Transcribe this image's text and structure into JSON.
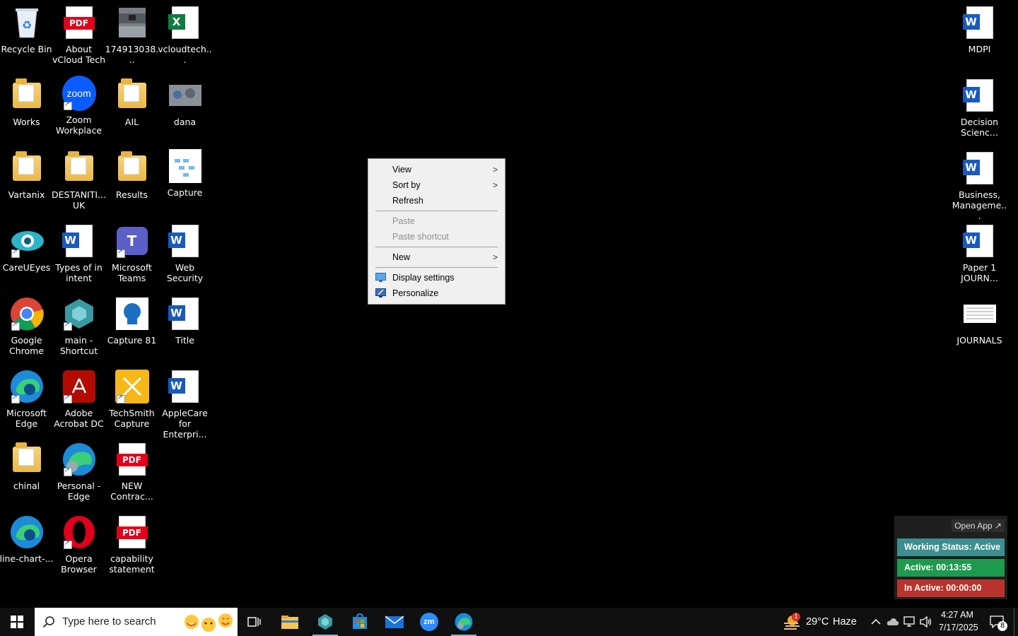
{
  "desktop": {
    "left_icons": [
      {
        "label": "Recycle Bin"
      },
      {
        "label": "About vCloud Tech"
      },
      {
        "label": "174913038..."
      },
      {
        "label": "vcloudtech..."
      },
      {
        "label": "Works"
      },
      {
        "label": "Zoom Workplace"
      },
      {
        "label": "AIL"
      },
      {
        "label": "dana"
      },
      {
        "label": "Vartanix"
      },
      {
        "label": "DESTANITI... UK"
      },
      {
        "label": "Results"
      },
      {
        "label": "Capture"
      },
      {
        "label": "CareUEyes"
      },
      {
        "label": "Types of in intent"
      },
      {
        "label": "Microsoft Teams"
      },
      {
        "label": "Web Security"
      },
      {
        "label": "Google Chrome"
      },
      {
        "label": "main - Shortcut"
      },
      {
        "label": "Capture 81"
      },
      {
        "label": "Title"
      },
      {
        "label": "Microsoft Edge"
      },
      {
        "label": "Adobe Acrobat DC"
      },
      {
        "label": "TechSmith Capture"
      },
      {
        "label": "AppleCare for Enterpri..."
      },
      {
        "label": "chinal"
      },
      {
        "label": "Personal - Edge"
      },
      {
        "label": "NEW Contrac..."
      },
      {
        "label": "line-chart-..."
      },
      {
        "label": "Opera Browser"
      },
      {
        "label": "capability statement"
      }
    ],
    "right_icons": [
      {
        "label": "MDPI"
      },
      {
        "label": "Decision Scienc..."
      },
      {
        "label": "Business, Manageme..."
      },
      {
        "label": "Paper 1 JOURN..."
      },
      {
        "label": "JOURNALS"
      }
    ]
  },
  "context_menu": {
    "view": "View",
    "sort_by": "Sort by",
    "refresh": "Refresh",
    "paste": "Paste",
    "paste_shortcut": "Paste shortcut",
    "new": "New",
    "display_settings": "Display settings",
    "personalize": "Personalize",
    "submenu_arrow": ">"
  },
  "status_widget": {
    "open_app": "Open App ↗",
    "working_status": "Working Status: Active",
    "active": "Active: 00:13:55",
    "inactive": "In Active: 00:00:00",
    "colors": {
      "working": "#3d8f8f",
      "active": "#1e9a4e",
      "inactive": "#b8332b"
    }
  },
  "taskbar": {
    "search_placeholder": "Type here to search",
    "weather": {
      "temp": "29°C",
      "condition": "Haze",
      "badge": "1"
    },
    "clock": {
      "time": "4:27 AM",
      "date": "7/17/2025"
    },
    "notification_count": "8",
    "zoom_label": "zm"
  },
  "icons": {
    "zoom_text": "zoom",
    "pdf_text": "PDF",
    "word_text": "W",
    "excel_text": "X",
    "teams_text": "T"
  }
}
